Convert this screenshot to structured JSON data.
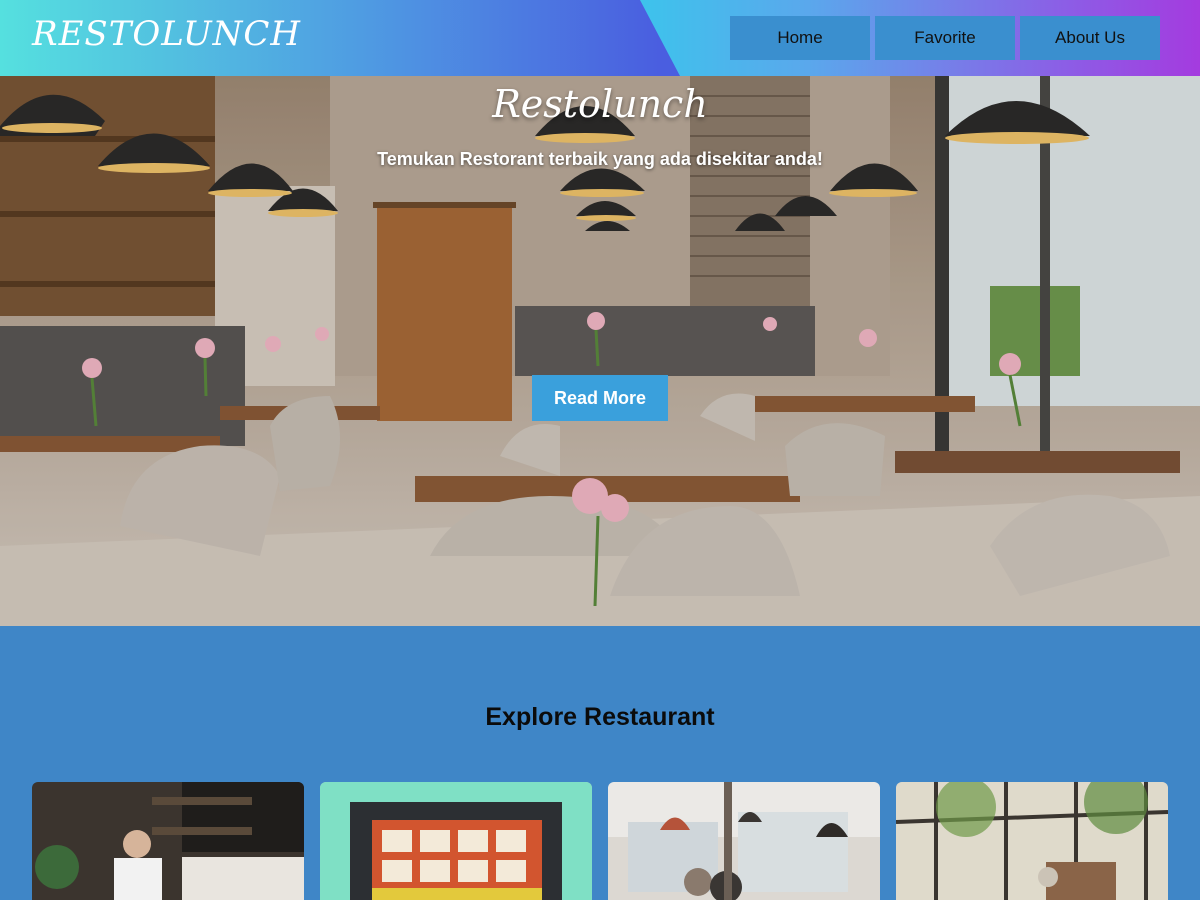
{
  "header": {
    "logo": "RESTOLUNCH",
    "nav": [
      {
        "label": "Home"
      },
      {
        "label": "Favorite"
      },
      {
        "label": "About Us"
      }
    ]
  },
  "hero": {
    "title": "Restolunch",
    "subtitle": "Temukan Restorant terbaik yang ada disekitar anda!",
    "button_label": "Read More"
  },
  "explore": {
    "title": "Explore Restaurant"
  },
  "colors": {
    "page_background": "#3f86c7",
    "nav_button": "#3a8fcf",
    "cta_button": "#3aa0dc"
  }
}
